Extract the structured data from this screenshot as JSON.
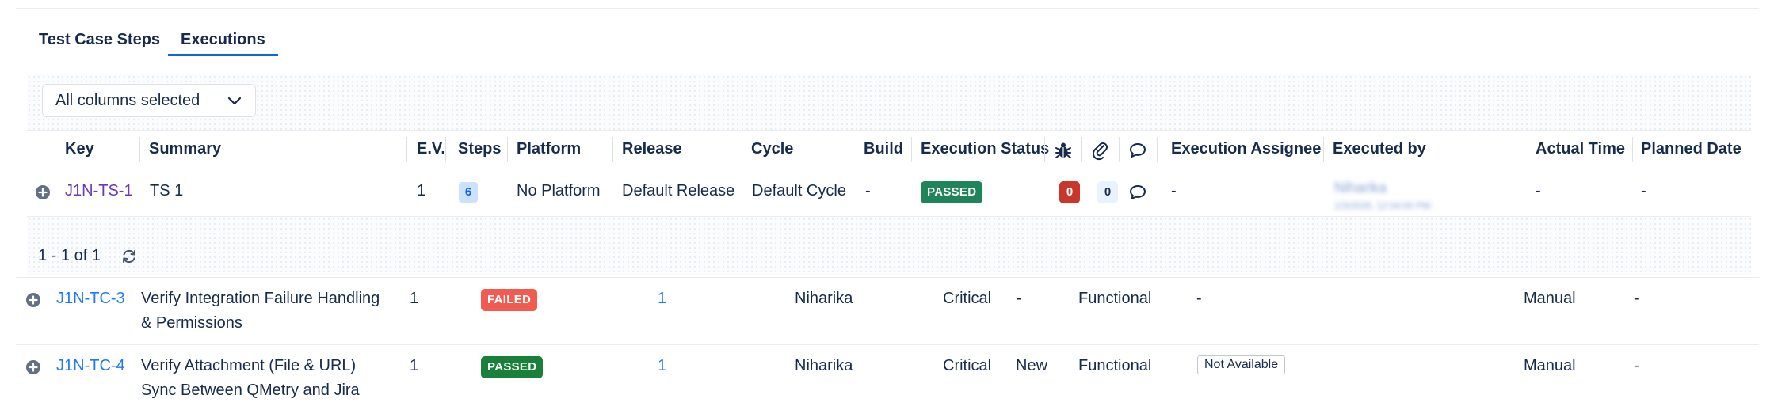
{
  "tabs": [
    {
      "label": "Test Case Steps",
      "active": false
    },
    {
      "label": "Executions",
      "active": true
    }
  ],
  "column_selector": {
    "label": "All columns selected"
  },
  "executions_table": {
    "headers": {
      "key": "Key",
      "summary": "Summary",
      "ev": "E.V.",
      "steps": "Steps",
      "platform": "Platform",
      "release": "Release",
      "cycle": "Cycle",
      "build": "Build",
      "execution_status": "Execution Status",
      "execution_assignee": "Execution Assignee",
      "executed_by": "Executed by",
      "actual_time": "Actual Time",
      "planned_date": "Planned Date"
    },
    "rows": [
      {
        "key": "J1N-TS-1",
        "summary": "TS 1",
        "ev": "1",
        "steps": "6",
        "platform": "No Platform",
        "release": "Default Release",
        "cycle": "Default Cycle",
        "build": "-",
        "status": "PASSED",
        "defects": "0",
        "attachments": "0",
        "assignee": "-",
        "executed_by_name": "Niharika",
        "executed_by_date": "1/3/2026, 12:04:00 PM",
        "actual_time": "-",
        "planned_date": "-"
      }
    ]
  },
  "pagination": {
    "text": "1 - 1 of 1"
  },
  "test_cases": [
    {
      "key": "J1N-TC-3",
      "summary_line1": "Verify Integration Failure Handling",
      "summary_line2": "& Permissions",
      "version": "1",
      "status": "FAILED",
      "executions": "1",
      "assignee": "Niharika",
      "priority": "Critical",
      "component": "-",
      "type": "Functional",
      "label": "-",
      "method": "Manual",
      "date": "-"
    },
    {
      "key": "J1N-TC-4",
      "summary_line1": "Verify Attachment (File & URL)",
      "summary_line2": "Sync Between QMetry and Jira",
      "version": "1",
      "status": "PASSED",
      "executions": "1",
      "assignee": "Niharika",
      "priority": "Critical",
      "component": "New",
      "type": "Functional",
      "label": "Not Available",
      "method": "Manual",
      "date": "-"
    }
  ],
  "colors": {
    "accent": "#0c66e4",
    "passed": "#1f845a",
    "failed": "#f15b50",
    "defect": "#c9372c"
  }
}
